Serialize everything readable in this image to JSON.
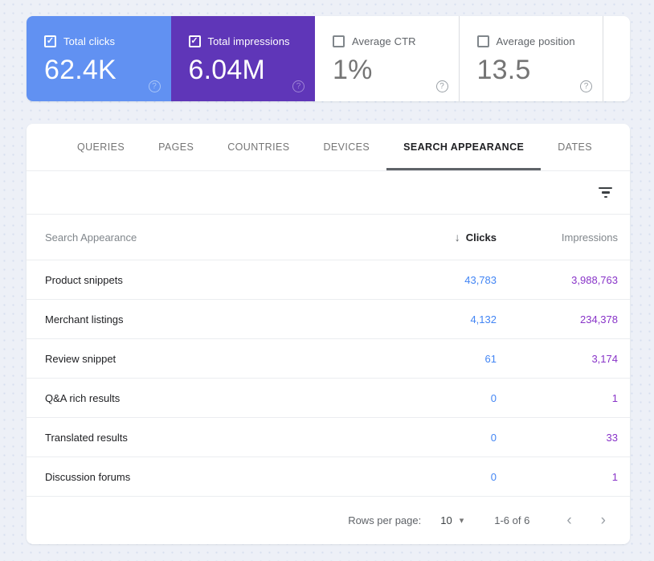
{
  "colors": {
    "page_bg": "#edf0f7",
    "clicks_card_bg": "#6191f2",
    "impressions_card_bg": "#5f36b8",
    "clicks_value_text": "#4285f4",
    "impressions_value_text": "#8833c8",
    "active_tab_underline": "#5f6368"
  },
  "icons": {
    "checkbox_check": "✓",
    "help": "?",
    "sort_desc": "↓",
    "dropdown": "▾",
    "prev": "‹",
    "next": "›"
  },
  "metric_cards": [
    {
      "label": "Total clicks",
      "value": "62.4K",
      "checked": true
    },
    {
      "label": "Total impressions",
      "value": "6.04M",
      "checked": true
    },
    {
      "label": "Average CTR",
      "value": "1%",
      "checked": false
    },
    {
      "label": "Average position",
      "value": "13.5",
      "checked": false
    }
  ],
  "tabs": [
    {
      "label": "QUERIES",
      "active": false
    },
    {
      "label": "PAGES",
      "active": false
    },
    {
      "label": "COUNTRIES",
      "active": false
    },
    {
      "label": "DEVICES",
      "active": false
    },
    {
      "label": "SEARCH APPEARANCE",
      "active": true
    },
    {
      "label": "DATES",
      "active": false
    }
  ],
  "table": {
    "header": {
      "dimension": "Search Appearance",
      "clicks": "Clicks",
      "impressions": "Impressions"
    },
    "rows": [
      {
        "dimension": "Product snippets",
        "clicks": "43,783",
        "impressions": "3,988,763"
      },
      {
        "dimension": "Merchant listings",
        "clicks": "4,132",
        "impressions": "234,378"
      },
      {
        "dimension": "Review snippet",
        "clicks": "61",
        "impressions": "3,174"
      },
      {
        "dimension": "Q&A rich results",
        "clicks": "0",
        "impressions": "1"
      },
      {
        "dimension": "Translated results",
        "clicks": "0",
        "impressions": "33"
      },
      {
        "dimension": "Discussion forums",
        "clicks": "0",
        "impressions": "1"
      }
    ]
  },
  "pagination": {
    "rows_per_page_label": "Rows per page:",
    "rows_per_page_value": "10",
    "range": "1-6 of 6"
  }
}
